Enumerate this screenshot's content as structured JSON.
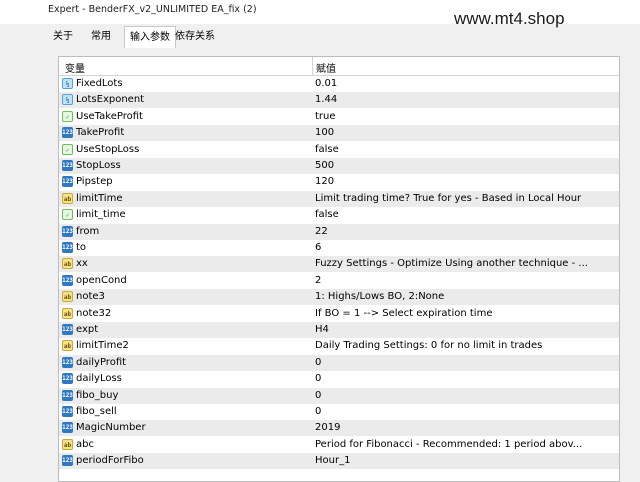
{
  "window": {
    "title": "Expert - BenderFX_v2_UNLIMITED EA_fix (2)"
  },
  "watermark": "www.mt4.shop",
  "tabs": [
    {
      "label": "关于",
      "active": false
    },
    {
      "label": "常用",
      "active": false
    },
    {
      "label": "输入参数",
      "active": true
    },
    {
      "label": "依存关系",
      "active": false
    }
  ],
  "table": {
    "headers": {
      "variable": "变量",
      "value": "赋值"
    },
    "rows": [
      {
        "name": "FixedLots",
        "value": "0.01",
        "icon": "double-icon"
      },
      {
        "name": "LotsExponent",
        "value": "1.44",
        "icon": "double-icon"
      },
      {
        "name": "UseTakeProfit",
        "value": "true",
        "icon": "bool-icon"
      },
      {
        "name": "TakeProfit",
        "value": "100",
        "icon": "int-icon"
      },
      {
        "name": "UseStopLoss",
        "value": "false",
        "icon": "bool-icon"
      },
      {
        "name": "StopLoss",
        "value": "500",
        "icon": "int-icon"
      },
      {
        "name": "Pipstep",
        "value": "120",
        "icon": "int-icon"
      },
      {
        "name": "limitTime",
        "value": "Limit trading time? True for yes - Based in Local Hour",
        "icon": "string-icon"
      },
      {
        "name": "limit_time",
        "value": "false",
        "icon": "bool-icon"
      },
      {
        "name": "from",
        "value": "22",
        "icon": "int-icon"
      },
      {
        "name": "to",
        "value": "6",
        "icon": "int-icon"
      },
      {
        "name": "xx",
        "value": "Fuzzy Settings - Optimize Using another technique - ...",
        "icon": "string-icon"
      },
      {
        "name": "openCond",
        "value": "2",
        "icon": "int-icon"
      },
      {
        "name": "note3",
        "value": "1: Highs/Lows BO, 2:None",
        "icon": "string-icon"
      },
      {
        "name": "note32",
        "value": "If BO = 1 --> Select expiration time",
        "icon": "string-icon"
      },
      {
        "name": "expt",
        "value": "H4",
        "icon": "int-icon"
      },
      {
        "name": "limitTime2",
        "value": "Daily Trading Settings: 0 for no limit in trades",
        "icon": "string-icon"
      },
      {
        "name": "dailyProfit",
        "value": "0",
        "icon": "int-icon"
      },
      {
        "name": "dailyLoss",
        "value": "0",
        "icon": "int-icon"
      },
      {
        "name": "fibo_buy",
        "value": "0",
        "icon": "int-icon"
      },
      {
        "name": "fibo_sell",
        "value": "0",
        "icon": "int-icon"
      },
      {
        "name": "MagicNumber",
        "value": "2019",
        "icon": "int-icon"
      },
      {
        "name": "abc",
        "value": "Period for Fibonacci - Recommended: 1 period abov...",
        "icon": "string-icon"
      },
      {
        "name": "periodForFibo",
        "value": "Hour_1",
        "icon": "int-icon"
      }
    ]
  },
  "colors": {
    "row_alt": "#ebebeb",
    "int_icon": "#2f78c4",
    "string_icon": "#f6e08a",
    "bool_icon": "#6cbf5c",
    "double_icon": "#bfe3f7"
  }
}
